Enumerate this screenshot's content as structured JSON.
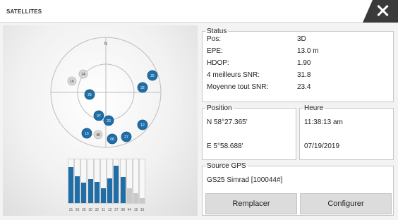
{
  "window": {
    "title": "SATELLITES"
  },
  "status": {
    "label": "Status",
    "rows": [
      {
        "key": "Pos:",
        "value": "3D"
      },
      {
        "key": "EPE:",
        "value": "13.0 m"
      },
      {
        "key": "HDOP:",
        "value": "1.90"
      },
      {
        "key": "4 meilleurs SNR:",
        "value": "31.8"
      },
      {
        "key": "Moyenne tout SNR:",
        "value": "23.4"
      }
    ]
  },
  "position": {
    "label": "Position",
    "lat": "N  58°27.365'",
    "lon": "E  5°58.688'"
  },
  "time": {
    "label": "Heure",
    "clock": "11:38:13 am",
    "date": "07/19/2019"
  },
  "source": {
    "label": "Source GPS",
    "value": "GS25 Simrad [100044#]"
  },
  "buttons": {
    "replace": "Remplacer",
    "configure": "Configurer"
  },
  "skyplot": {
    "north_label": "N",
    "satellites": [
      {
        "id": "16",
        "active": false
      },
      {
        "id": "24",
        "active": false
      },
      {
        "id": "26",
        "active": true
      },
      {
        "id": "25",
        "active": true
      },
      {
        "id": "32",
        "active": true
      },
      {
        "id": "07",
        "active": true
      },
      {
        "id": "23",
        "active": true
      },
      {
        "id": "12",
        "active": true
      },
      {
        "id": "27",
        "active": true
      },
      {
        "id": "15",
        "active": true
      },
      {
        "id": "48",
        "active": false
      },
      {
        "id": "08",
        "active": true
      }
    ]
  },
  "snr_bars": [
    {
      "id": "31",
      "level": 0.82,
      "active": true
    },
    {
      "id": "25",
      "level": 0.62,
      "active": true
    },
    {
      "id": "26",
      "level": 0.46,
      "active": true
    },
    {
      "id": "30",
      "level": 0.55,
      "active": true
    },
    {
      "id": "32",
      "level": 0.48,
      "active": true
    },
    {
      "id": "11",
      "level": 0.34,
      "active": true
    },
    {
      "id": "12",
      "level": 0.56,
      "active": true
    },
    {
      "id": "27",
      "level": 0.86,
      "active": true
    },
    {
      "id": "08",
      "level": 0.6,
      "active": true
    },
    {
      "id": "44",
      "level": 0.34,
      "active": false
    },
    {
      "id": "15",
      "level": 0.22,
      "active": false
    },
    {
      "id": "16",
      "level": 0.12,
      "active": false
    }
  ],
  "colors": {
    "active": "#1f6ea8",
    "inactive": "#d8d8d8",
    "inactive_bar": "#c9c9c9"
  }
}
